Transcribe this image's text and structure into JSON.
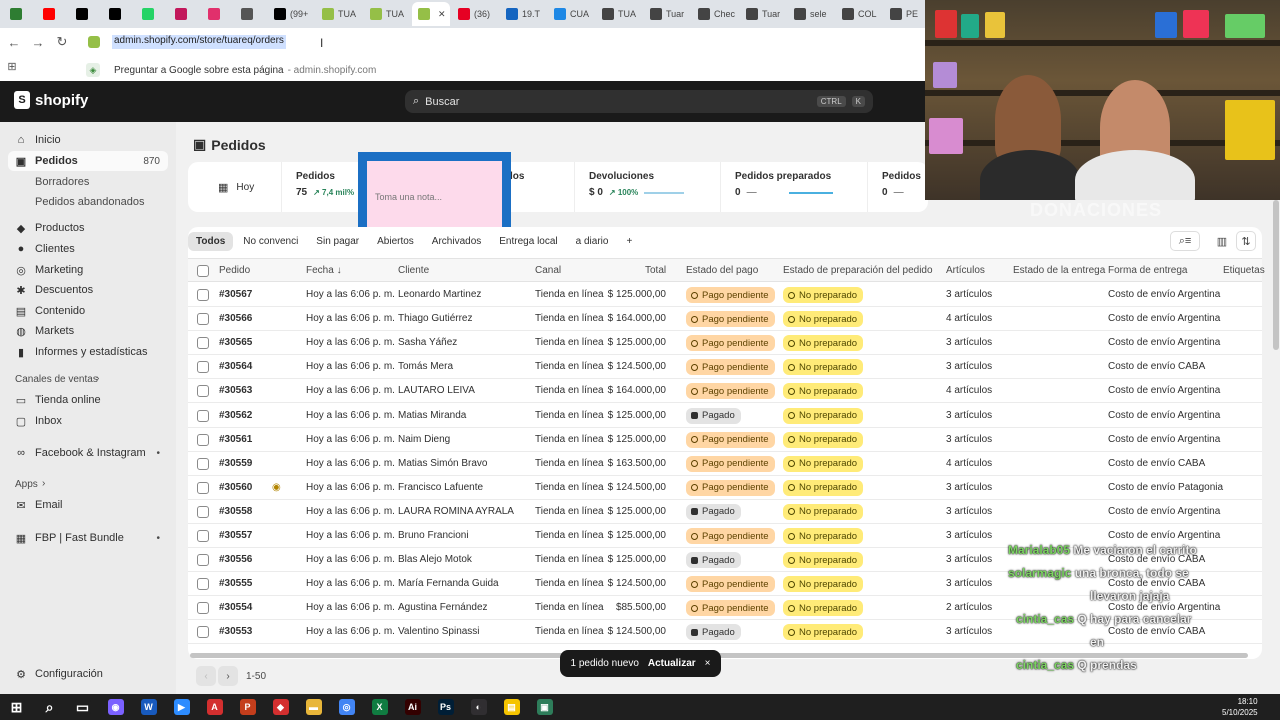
{
  "browser": {
    "tabs": [
      {
        "label": "",
        "color": "#2e7d32"
      },
      {
        "label": "",
        "color": "#ff0000"
      },
      {
        "label": "",
        "color": "#000000"
      },
      {
        "label": "",
        "color": "#000000"
      },
      {
        "label": "",
        "color": "#25d366"
      },
      {
        "label": "",
        "color": "#c2185b"
      },
      {
        "label": "",
        "color": "#e1306c"
      },
      {
        "label": "",
        "color": "#555555"
      },
      {
        "label": "(99+",
        "color": "#000000"
      },
      {
        "label": "TUA",
        "color": "#95bf47"
      },
      {
        "label": "TUA",
        "color": "#95bf47"
      },
      {
        "label": "",
        "color": "#95bf47",
        "active": true
      },
      {
        "label": "(36)",
        "color": "#e60023"
      },
      {
        "label": "19.T",
        "color": "#1565c0"
      },
      {
        "label": "CUA",
        "color": "#1e88e5"
      },
      {
        "label": "TUA",
        "color": "#444444"
      },
      {
        "label": "Tuar",
        "color": "#444444"
      },
      {
        "label": "Chec",
        "color": "#444444"
      },
      {
        "label": "Tuar",
        "color": "#444444"
      },
      {
        "label": "sele",
        "color": "#444444"
      },
      {
        "label": "COL",
        "color": "#444444"
      },
      {
        "label": "PE",
        "color": "#444444"
      }
    ],
    "url": "admin.shopify.com/store/tuareq/orders",
    "suggestion_text": "Preguntar a Google sobre esta página",
    "suggestion_domain": "- admin.shopify.com"
  },
  "shopify": {
    "brand": "shopify",
    "search_placeholder": "Buscar",
    "shortcut_ctrl": "CTRL",
    "shortcut_key": "K"
  },
  "sidebar": {
    "items": [
      {
        "label": "Inicio",
        "icon": "home-icon",
        "glyph": "⌂"
      },
      {
        "label": "Pedidos",
        "icon": "orders-icon",
        "glyph": "▣",
        "count": "870"
      },
      {
        "label": "Borradores"
      },
      {
        "label": "Pedidos abandonados"
      },
      {
        "label": "Productos",
        "icon": "tag-icon",
        "glyph": "◆"
      },
      {
        "label": "Clientes",
        "icon": "person-icon",
        "glyph": "●"
      },
      {
        "label": "Marketing",
        "icon": "target-icon",
        "glyph": "◎"
      },
      {
        "label": "Descuentos",
        "icon": "discount-icon",
        "glyph": "✱"
      },
      {
        "label": "Contenido",
        "icon": "content-icon",
        "glyph": "▤"
      },
      {
        "label": "Markets",
        "icon": "globe-icon",
        "glyph": "◍"
      },
      {
        "label": "Informes y estadísticas",
        "icon": "chart-icon",
        "glyph": "▮"
      }
    ],
    "sales_channels_heading": "Canales de ventas",
    "channels": [
      {
        "label": "Tienda online",
        "glyph": "▭"
      },
      {
        "label": "Inbox",
        "glyph": "▢"
      },
      {
        "label": "Facebook & Instagram",
        "glyph": "∞"
      }
    ],
    "apps_heading": "Apps",
    "apps": [
      {
        "label": "Email",
        "glyph": "✉"
      },
      {
        "label": "FBP | Fast Bundle",
        "glyph": "▦"
      }
    ],
    "settings_label": "Configuración"
  },
  "page": {
    "title": "Pedidos",
    "metrics": {
      "today": "Hoy",
      "orders_label": "Pedidos",
      "orders_value": "75",
      "orders_change": "↗ 7,4 mil%",
      "partial_label": "los",
      "returns_label": "Devoluciones",
      "returns_value": "$ 0",
      "returns_change": "↗ 100%",
      "prepared_label": "Pedidos preparados",
      "prepared_value": "0",
      "prepared_dash": "—",
      "extra_label": "Pedidos",
      "extra_value": "0",
      "extra_dash": "—"
    },
    "note_placeholder": "Toma una nota...",
    "filter_tabs": [
      "Todos",
      "No convenci",
      "Sin pagar",
      "Abiertos",
      "Archivados",
      "Entrega local",
      "a diario"
    ],
    "add_tab": "+",
    "columns": {
      "order": "Pedido",
      "date": "Fecha ↓",
      "customer": "Cliente",
      "channel": "Canal",
      "total": "Total",
      "payment": "Estado del pago",
      "fulfillment": "Estado de preparación del pedido",
      "items": "Artículos",
      "delivery": "Estado de la entrega",
      "method": "Forma de entrega",
      "tags": "Etiquetas"
    },
    "rows": [
      {
        "order": "#30567",
        "date": "Hoy a las 6:06 p. m.",
        "customer": "Leonardo Martinez",
        "channel": "Tienda en línea",
        "total": "$ 125.000,00",
        "payment": "Pago pendiente",
        "paid": false,
        "fulfillment": "No preparado",
        "items": "3 artículos",
        "method": "Costo de envío Argentina"
      },
      {
        "order": "#30566",
        "date": "Hoy a las 6:06 p. m.",
        "customer": "Thiago Gutiérrez",
        "channel": "Tienda en línea",
        "total": "$ 164.000,00",
        "payment": "Pago pendiente",
        "paid": false,
        "fulfillment": "No preparado",
        "items": "4 artículos",
        "method": "Costo de envío Argentina"
      },
      {
        "order": "#30565",
        "date": "Hoy a las 6:06 p. m.",
        "customer": "Sasha Yáñez",
        "channel": "Tienda en línea",
        "total": "$ 125.000,00",
        "payment": "Pago pendiente",
        "paid": false,
        "fulfillment": "No preparado",
        "items": "3 artículos",
        "method": "Costo de envío Argentina"
      },
      {
        "order": "#30564",
        "date": "Hoy a las 6:06 p. m.",
        "customer": "Tomás Mera",
        "channel": "Tienda en línea",
        "total": "$ 124.500,00",
        "payment": "Pago pendiente",
        "paid": false,
        "fulfillment": "No preparado",
        "items": "3 artículos",
        "method": "Costo de envío CABA"
      },
      {
        "order": "#30563",
        "date": "Hoy a las 6:06 p. m.",
        "customer": "LAUTARO LEIVA",
        "channel": "Tienda en línea",
        "total": "$ 164.000,00",
        "payment": "Pago pendiente",
        "paid": false,
        "fulfillment": "No preparado",
        "items": "4 artículos",
        "method": "Costo de envío Argentina"
      },
      {
        "order": "#30562",
        "date": "Hoy a las 6:06 p. m.",
        "customer": "Matias Miranda",
        "channel": "Tienda en línea",
        "total": "$ 125.000,00",
        "payment": "Pagado",
        "paid": true,
        "fulfillment": "No preparado",
        "items": "3 artículos",
        "method": "Costo de envío Argentina"
      },
      {
        "order": "#30561",
        "date": "Hoy a las 6:06 p. m.",
        "customer": "Naim Dieng",
        "channel": "Tienda en línea",
        "total": "$ 125.000,00",
        "payment": "Pago pendiente",
        "paid": false,
        "fulfillment": "No preparado",
        "items": "3 artículos",
        "method": "Costo de envío Argentina"
      },
      {
        "order": "#30559",
        "date": "Hoy a las 6:06 p. m.",
        "customer": "Matias Simón Bravo",
        "channel": "Tienda en línea",
        "total": "$ 163.500,00",
        "payment": "Pago pendiente",
        "paid": false,
        "fulfillment": "No preparado",
        "items": "4 artículos",
        "method": "Costo de envío CABA"
      },
      {
        "order": "#30560",
        "date": "Hoy a las 6:06 p. m.",
        "customer": "Francisco Lafuente",
        "channel": "Tienda en línea",
        "total": "$ 124.500,00",
        "payment": "Pago pendiente",
        "paid": false,
        "fulfillment": "No preparado",
        "items": "3 artículos",
        "method": "Costo de envío Patagonia",
        "flag": true
      },
      {
        "order": "#30558",
        "date": "Hoy a las 6:06 p. m.",
        "customer": "LAURA ROMINA AYRALA",
        "channel": "Tienda en línea",
        "total": "$ 125.000,00",
        "payment": "Pagado",
        "paid": true,
        "fulfillment": "No preparado",
        "items": "3 artículos",
        "method": "Costo de envío Argentina"
      },
      {
        "order": "#30557",
        "date": "Hoy a las 6:06 p. m.",
        "customer": "Bruno Francioni",
        "channel": "Tienda en línea",
        "total": "$ 125.000,00",
        "payment": "Pago pendiente",
        "paid": false,
        "fulfillment": "No preparado",
        "items": "3 artículos",
        "method": "Costo de envío Argentina"
      },
      {
        "order": "#30556",
        "date": "Hoy a las 6:06 p. m.",
        "customer": "Blas Alejo Motok",
        "channel": "Tienda en línea",
        "total": "$ 125.000,00",
        "payment": "Pagado",
        "paid": true,
        "fulfillment": "No preparado",
        "items": "3 artículos",
        "method": "Costo de envío CABA"
      },
      {
        "order": "#30555",
        "date": "Hoy a las 6:06 p. m.",
        "customer": "María Fernanda Guida",
        "channel": "Tienda en línea",
        "total": "$ 124.500,00",
        "payment": "Pago pendiente",
        "paid": false,
        "fulfillment": "No preparado",
        "items": "3 artículos",
        "method": "Costo de envío CABA"
      },
      {
        "order": "#30554",
        "date": "Hoy a las 6:06 p. m.",
        "customer": "Agustina Fernández",
        "channel": "Tienda en línea",
        "total": "$85.500,00",
        "payment": "Pago pendiente",
        "paid": false,
        "fulfillment": "No preparado",
        "items": "2 artículos",
        "method": "Costo de envío Argentina"
      },
      {
        "order": "#30553",
        "date": "Hoy a las 6:06 p. m.",
        "customer": "Valentino Spinassi",
        "channel": "Tienda en línea",
        "total": "$ 124.500,00",
        "payment": "Pagado",
        "paid": true,
        "fulfillment": "No preparado",
        "items": "3 artículos",
        "method": "Costo de envío CABA"
      }
    ],
    "pager_range": "1-50",
    "toast_text": "1 pedido nuevo",
    "toast_action": "Actualizar",
    "toast_close": "×"
  },
  "stream": {
    "banner": "DONACIONES",
    "chat": [
      {
        "user": "Marialab05",
        "msg": "Me vaciaron el carrito"
      },
      {
        "user": "solarmagic",
        "msg": "una bronca, todo se"
      },
      {
        "user": "",
        "msg": "llevaron jajaja"
      },
      {
        "user": "cintia_cas",
        "msg": "Q hay para cancelar"
      },
      {
        "user": "",
        "msg": "en"
      },
      {
        "user": "cintia_cas",
        "msg": "Q prendas"
      }
    ]
  },
  "taskbar": {
    "apps": [
      {
        "name": "windows-icon",
        "glyph": "⊞",
        "color": "#1f1f1f"
      },
      {
        "name": "search-icon",
        "glyph": "⌕",
        "color": "#1f1f1f"
      },
      {
        "name": "taskview-icon",
        "glyph": "▭",
        "color": "#1f1f1f"
      },
      {
        "name": "copilot-icon",
        "glyph": "◉",
        "color": "#7b61ff"
      },
      {
        "name": "word-icon",
        "glyph": "W",
        "color": "#185abd"
      },
      {
        "name": "zoom-icon",
        "glyph": "▶",
        "color": "#2d8cff"
      },
      {
        "name": "acrobat-icon",
        "glyph": "A",
        "color": "#d32f2f"
      },
      {
        "name": "powerpoint-icon",
        "glyph": "P",
        "color": "#c43e1c"
      },
      {
        "name": "anydesk-icon",
        "glyph": "◆",
        "color": "#d32f2f"
      },
      {
        "name": "folder-icon",
        "glyph": "▬",
        "color": "#e8b63a"
      },
      {
        "name": "chrome-icon",
        "glyph": "◎",
        "color": "#4285f4"
      },
      {
        "name": "excel-icon",
        "glyph": "X",
        "color": "#107c41"
      },
      {
        "name": "illustrator-icon",
        "glyph": "Ai",
        "color": "#330000"
      },
      {
        "name": "photoshop-icon",
        "glyph": "Ps",
        "color": "#001e36"
      },
      {
        "name": "obs-icon",
        "glyph": "◐",
        "color": "#302e31"
      },
      {
        "name": "notes-icon",
        "glyph": "▤",
        "color": "#f5c400"
      },
      {
        "name": "app-icon",
        "glyph": "▣",
        "color": "#2e7d5a"
      }
    ],
    "time": "18:10",
    "date": "5/10/2025"
  }
}
